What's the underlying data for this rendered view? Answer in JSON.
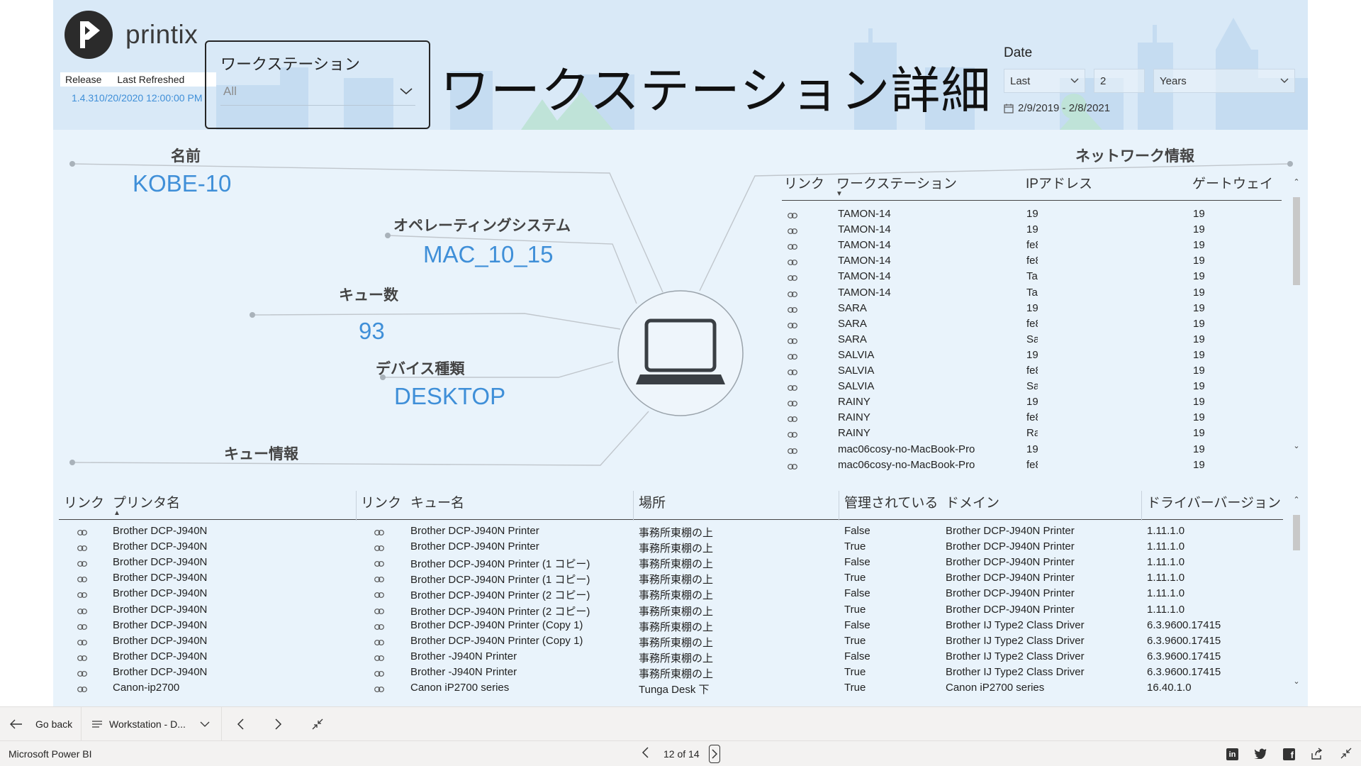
{
  "header": {
    "logo_text": "printix",
    "release_tab": "Release",
    "last_refreshed_tab": "Last Refreshed",
    "release_version": "1.4.3",
    "last_refreshed_value": "10/20/2020 12:00:00 PM",
    "page_title": "ワークステーション詳細"
  },
  "workstation_slicer": {
    "label": "ワークステーション",
    "value": "All"
  },
  "date_filter": {
    "label": "Date",
    "relative": "Last",
    "amount": "2",
    "unit": "Years",
    "range": "2/9/2019 - 2/8/2021"
  },
  "cards": {
    "name": {
      "label": "名前",
      "value": "KOBE-10"
    },
    "os": {
      "label": "オペレーティングシステム",
      "value": "MAC_10_15"
    },
    "queue_count": {
      "label": "キュー数",
      "value": "93"
    },
    "device_type": {
      "label": "デバイス種類",
      "value": "DESKTOP"
    },
    "queue_info": {
      "label": "キュー情報"
    },
    "network_info": {
      "label": "ネットワーク情報"
    }
  },
  "network_table": {
    "headers": [
      "リンク",
      "ワークステーション",
      "IPアドレス",
      "ゲートウェイ"
    ],
    "rows": [
      [
        "TAMON-14",
        "19",
        "19"
      ],
      [
        "TAMON-14",
        "19",
        "19"
      ],
      [
        "TAMON-14",
        "fe8",
        "19"
      ],
      [
        "TAMON-14",
        "fe8",
        "19"
      ],
      [
        "TAMON-14",
        "Ta",
        "19"
      ],
      [
        "TAMON-14",
        "Ta",
        "19"
      ],
      [
        "SARA",
        "19",
        "19"
      ],
      [
        "SARA",
        "fe8",
        "19"
      ],
      [
        "SARA",
        "Sa",
        "19"
      ],
      [
        "SALVIA",
        "19",
        "19"
      ],
      [
        "SALVIA",
        "fe8",
        "19"
      ],
      [
        "SALVIA",
        "Sa",
        "19"
      ],
      [
        "RAINY",
        "19",
        "19"
      ],
      [
        "RAINY",
        "fe8",
        "19"
      ],
      [
        "RAINY",
        "Ra",
        "19"
      ],
      [
        "mac06cosy-no-MacBook-Pro",
        "19",
        "19"
      ],
      [
        "mac06cosy-no-MacBook-Pro",
        "fe8",
        "19"
      ]
    ]
  },
  "queue_table": {
    "headers": [
      "リンク",
      "プリンタ名",
      "リンク",
      "キュー名",
      "場所",
      "管理されている",
      "ドメイン",
      "ドライバーバージョン"
    ],
    "rows": [
      [
        "Brother DCP-J940N",
        "Brother DCP-J940N Printer",
        "事務所東棚の上",
        "False",
        "Brother DCP-J940N Printer",
        "1.11.1.0"
      ],
      [
        "Brother DCP-J940N",
        "Brother DCP-J940N Printer",
        "事務所東棚の上",
        "True",
        "Brother DCP-J940N Printer",
        "1.11.1.0"
      ],
      [
        "Brother DCP-J940N",
        "Brother DCP-J940N Printer (1 コピー)",
        "事務所東棚の上",
        "False",
        "Brother DCP-J940N Printer",
        "1.11.1.0"
      ],
      [
        "Brother DCP-J940N",
        "Brother DCP-J940N Printer (1 コピー)",
        "事務所東棚の上",
        "True",
        "Brother DCP-J940N Printer",
        "1.11.1.0"
      ],
      [
        "Brother DCP-J940N",
        "Brother DCP-J940N Printer (2 コピー)",
        "事務所東棚の上",
        "False",
        "Brother DCP-J940N Printer",
        "1.11.1.0"
      ],
      [
        "Brother DCP-J940N",
        "Brother DCP-J940N Printer (2 コピー)",
        "事務所東棚の上",
        "True",
        "Brother DCP-J940N Printer",
        "1.11.1.0"
      ],
      [
        "Brother DCP-J940N",
        "Brother DCP-J940N Printer (Copy 1)",
        "事務所東棚の上",
        "False",
        "Brother IJ Type2 Class Driver",
        "6.3.9600.17415"
      ],
      [
        "Brother DCP-J940N",
        "Brother DCP-J940N Printer (Copy 1)",
        "事務所東棚の上",
        "True",
        "Brother IJ Type2 Class Driver",
        "6.3.9600.17415"
      ],
      [
        "Brother DCP-J940N",
        "Brother -J940N Printer",
        "事務所東棚の上",
        "False",
        "Brother IJ Type2 Class Driver",
        "6.3.9600.17415"
      ],
      [
        "Brother DCP-J940N",
        "Brother -J940N Printer",
        "事務所東棚の上",
        "True",
        "Brother IJ Type2 Class Driver",
        "6.3.9600.17415"
      ],
      [
        "Canon-ip2700",
        "Canon iP2700 series",
        "Tunga Desk 下",
        "True",
        "Canon iP2700 series",
        "16.40.1.0"
      ]
    ]
  },
  "bottom_bar": {
    "go_back": "Go back",
    "page_name": "Workstation - D..."
  },
  "status_bar": {
    "app_name": "Microsoft Power BI",
    "page_counter": "12 of 14"
  },
  "colors": {
    "canvas_bg": "#e9f3fb",
    "header_bg": "#d9e9f7",
    "accent_blue": "#3f8fd8",
    "chrome_bg": "#f3f2f1"
  }
}
